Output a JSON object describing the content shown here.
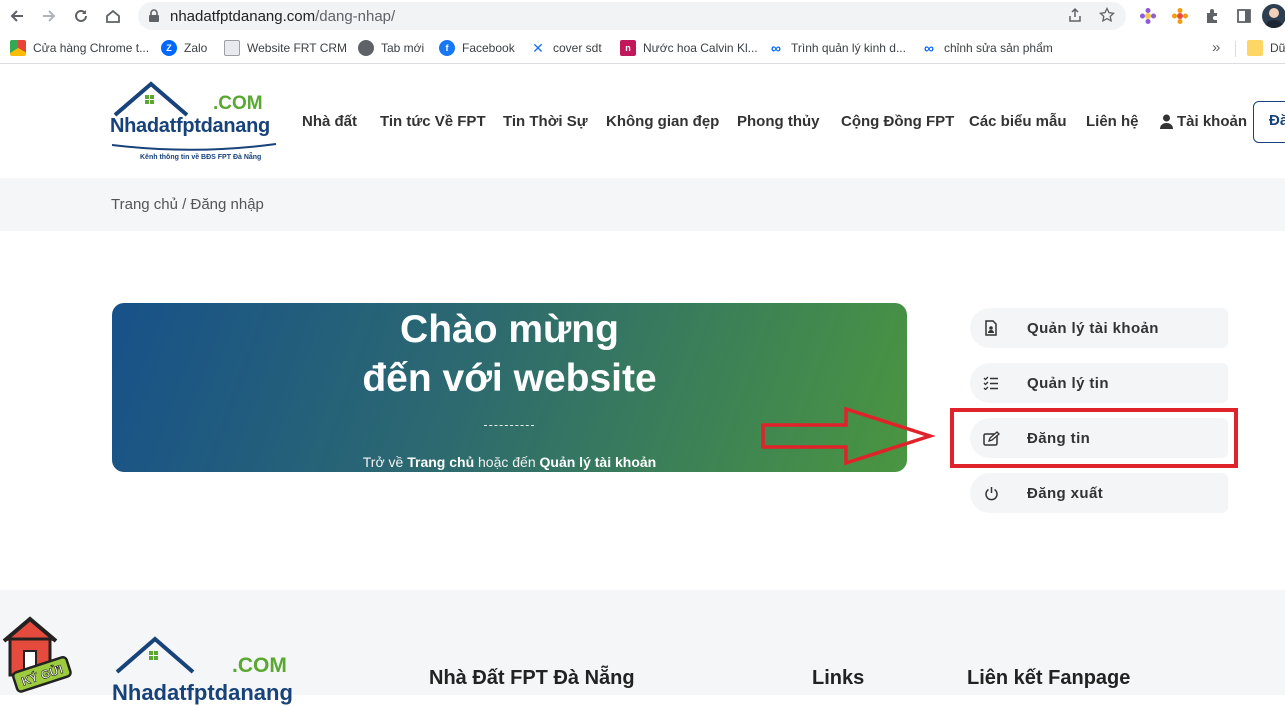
{
  "browser": {
    "url_domain": "nhadatfptdanang.com",
    "url_path": "/dang-nhap/",
    "bookmarks": [
      {
        "label": "Cửa hàng Chrome t...",
        "icon": "chrome-store-icon"
      },
      {
        "label": "Zalo",
        "icon": "zalo-icon"
      },
      {
        "label": "Website FRT CRM",
        "icon": "document-icon"
      },
      {
        "label": "Tab mới",
        "icon": "globe-icon"
      },
      {
        "label": "Facebook",
        "icon": "facebook-icon"
      },
      {
        "label": "cover sdt",
        "icon": "capcut-icon"
      },
      {
        "label": "Nước hoa Calvin Kl...",
        "icon": "n-icon"
      },
      {
        "label": "Trình quản lý kinh d...",
        "icon": "meta-icon"
      },
      {
        "label": "chỉnh sửa sản phẩm",
        "icon": "meta-icon"
      },
      {
        "label": "Dữ",
        "icon": "folder-icon"
      }
    ],
    "more_label": "»"
  },
  "header": {
    "logo_com": ".COM",
    "logo_brand": "Nhadatfptdanang",
    "logo_tagline": "Kênh thông tin về BĐS FPT Đà Nẵng",
    "nav": [
      "Nhà đất",
      "Tin tức Về FPT",
      "Tin Thời Sự",
      "Không gian đẹp",
      "Phong thủy",
      "Cộng Đồng FPT",
      "Các biểu mẫu",
      "Liên hệ"
    ],
    "account_label": "Tài khoản",
    "post_button": "Đă"
  },
  "breadcrumb": {
    "home": "Trang chủ",
    "separator": "/",
    "current": "Đăng nhập"
  },
  "banner": {
    "line1": "Chào mừng",
    "line2": "đến với website",
    "back_prefix": "Trở về",
    "home_link": "Trang chủ",
    "middle": "hoặc đến",
    "account_link": "Quản lý tài khoản"
  },
  "side_menu": [
    {
      "label": "Quản lý tài khoản",
      "icon": "account-file-icon"
    },
    {
      "label": "Quản lý tin",
      "icon": "list-check-icon"
    },
    {
      "label": "Đăng tin",
      "icon": "edit-post-icon"
    },
    {
      "label": "Đăng xuất",
      "icon": "power-icon"
    }
  ],
  "footer": {
    "logo_com": ".COM",
    "logo_brand": "Nhadatfptdanang",
    "col1_title": "Nhà Đất FPT Đà Nẵng",
    "col2_title": "Links",
    "col3_title": "Liên kết Fanpage",
    "badge_label": "KÝ GỬI"
  },
  "colors": {
    "brand_blue": "#17427a",
    "brand_green": "#5aa832",
    "annotation_red": "#e0222a"
  }
}
